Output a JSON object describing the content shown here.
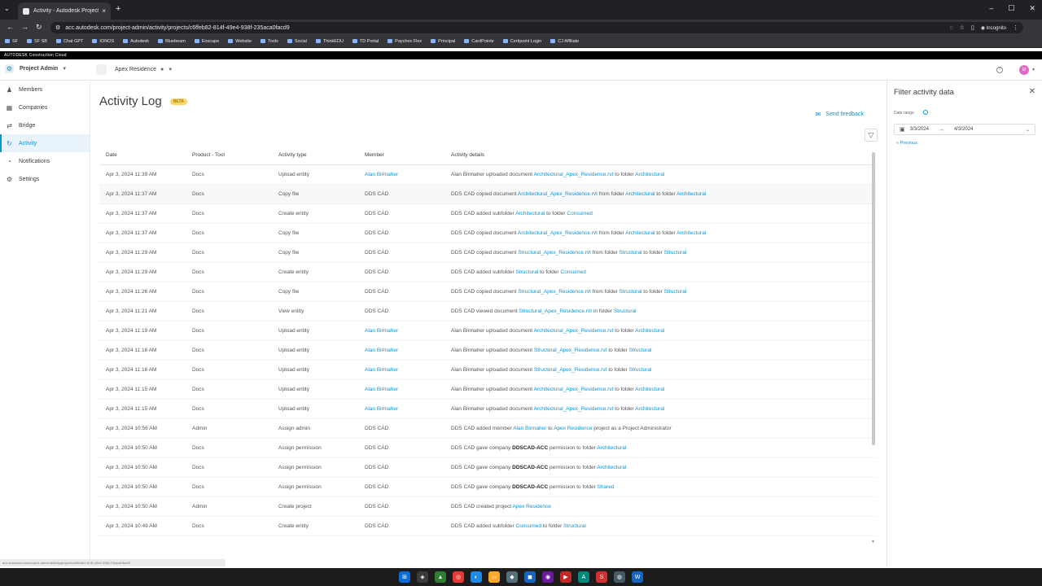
{
  "browser": {
    "tab_title": "Activity - Autodesk Project Adm",
    "tab_close": "×",
    "new_tab": "+",
    "url": "acc.autodesk.com/project-admin/activity/projects/c6ffeb82-814f-49e4-938f-235aca0facd9",
    "profile_label": "Incognito",
    "bookmarks": [
      "SF",
      "SF SB",
      "Chat GPT",
      "IONOS",
      "Autodesk",
      "Bluebeam",
      "Enscape",
      "Website",
      "Tools",
      "Social",
      "ThinkEDU",
      "TD Portal",
      "Paychex Flex",
      "Principal",
      "CardPointe",
      "Certipoint Login",
      "CJ Affiliate"
    ]
  },
  "brand_bar": "AUTODESK Construction Cloud",
  "header": {
    "module": "Project Admin",
    "project": "Apex Residence",
    "avatar_initials": "EI"
  },
  "sidebar": {
    "items": [
      {
        "label": "Members",
        "icon": "members-icon"
      },
      {
        "label": "Companies",
        "icon": "companies-icon"
      },
      {
        "label": "Bridge",
        "icon": "bridge-icon"
      },
      {
        "label": "Activity",
        "icon": "activity-icon",
        "active": true
      },
      {
        "label": "Notifications",
        "icon": "notifications-icon"
      },
      {
        "label": "Settings",
        "icon": "settings-icon"
      }
    ]
  },
  "main": {
    "title": "Activity Log",
    "beta_badge": "BETA",
    "feedback_label": "Send feedback"
  },
  "table": {
    "columns": [
      "Date",
      "Product - Tool",
      "Activity type",
      "Member",
      "Activity details"
    ],
    "rows": [
      {
        "date": "Apr 3, 2024 11:39 AM",
        "product": "Docs",
        "type": "Upload entity",
        "member": "Alan Birmaher",
        "member_link": true,
        "details": [
          [
            "t",
            "Alan Birmaher uploaded document "
          ],
          [
            "l",
            "Architectural_Apex_Residence.rvt"
          ],
          [
            "t",
            " to folder "
          ],
          [
            "l",
            "Architectural"
          ]
        ]
      },
      {
        "date": "Apr 3, 2024 11:37 AM",
        "product": "Docs",
        "type": "Copy file",
        "member": "DDS CAD",
        "member_link": false,
        "details": [
          [
            "t",
            "DDS CAD copied document "
          ],
          [
            "l",
            "Architectural_Apex_Residence.rvt"
          ],
          [
            "t",
            " from folder "
          ],
          [
            "l",
            "Architectural"
          ],
          [
            "t",
            " to folder "
          ],
          [
            "l",
            "Architectural"
          ]
        ]
      },
      {
        "date": "Apr 3, 2024 11:37 AM",
        "product": "Docs",
        "type": "Create entity",
        "member": "DDS CAD",
        "member_link": false,
        "details": [
          [
            "t",
            "DDS CAD added subfolder "
          ],
          [
            "l",
            "Architectural"
          ],
          [
            "t",
            " to folder "
          ],
          [
            "l",
            "Consumed"
          ]
        ]
      },
      {
        "date": "Apr 3, 2024 11:37 AM",
        "product": "Docs",
        "type": "Copy file",
        "member": "DDS CAD",
        "member_link": false,
        "details": [
          [
            "t",
            "DDS CAD copied document "
          ],
          [
            "l",
            "Architectural_Apex_Residence.rvt"
          ],
          [
            "t",
            " from folder "
          ],
          [
            "l",
            "Architectural"
          ],
          [
            "t",
            " to folder "
          ],
          [
            "l",
            "Architectural"
          ]
        ]
      },
      {
        "date": "Apr 3, 2024 11:29 AM",
        "product": "Docs",
        "type": "Copy file",
        "member": "DDS CAD",
        "member_link": false,
        "details": [
          [
            "t",
            "DDS CAD copied document "
          ],
          [
            "l",
            "Structural_Apex_Residence.rvt"
          ],
          [
            "t",
            " from folder "
          ],
          [
            "l",
            "Structural"
          ],
          [
            "t",
            " to folder "
          ],
          [
            "l",
            "Structural"
          ]
        ]
      },
      {
        "date": "Apr 3, 2024 11:29 AM",
        "product": "Docs",
        "type": "Create entity",
        "member": "DDS CAD",
        "member_link": false,
        "details": [
          [
            "t",
            "DDS CAD added subfolder "
          ],
          [
            "l",
            "Structural"
          ],
          [
            "t",
            " to folder "
          ],
          [
            "l",
            "Consumed"
          ]
        ]
      },
      {
        "date": "Apr 3, 2024 11:26 AM",
        "product": "Docs",
        "type": "Copy file",
        "member": "DDS CAD",
        "member_link": false,
        "details": [
          [
            "t",
            "DDS CAD copied document "
          ],
          [
            "l",
            "Structural_Apex_Residence.rvt"
          ],
          [
            "t",
            " from folder "
          ],
          [
            "l",
            "Structural"
          ],
          [
            "t",
            " to folder "
          ],
          [
            "l",
            "Structural"
          ]
        ]
      },
      {
        "date": "Apr 3, 2024 11:21 AM",
        "product": "Docs",
        "type": "View entity",
        "member": "DDS CAD",
        "member_link": false,
        "details": [
          [
            "t",
            "DDS CAD viewed document "
          ],
          [
            "l",
            "Structural_Apex_Residence.rvt"
          ],
          [
            "t",
            " in folder "
          ],
          [
            "l",
            "Structural"
          ]
        ]
      },
      {
        "date": "Apr 3, 2024 11:19 AM",
        "product": "Docs",
        "type": "Upload entity",
        "member": "Alan Birmaher",
        "member_link": true,
        "details": [
          [
            "t",
            "Alan Birmaher uploaded document "
          ],
          [
            "l",
            "Architectural_Apex_Residence.rvt"
          ],
          [
            "t",
            " to folder "
          ],
          [
            "l",
            "Architectural"
          ]
        ]
      },
      {
        "date": "Apr 3, 2024 11:16 AM",
        "product": "Docs",
        "type": "Upload entity",
        "member": "Alan Birmaher",
        "member_link": true,
        "details": [
          [
            "t",
            "Alan Birmaher uploaded document "
          ],
          [
            "l",
            "Structural_Apex_Residence.rvt"
          ],
          [
            "t",
            " to folder "
          ],
          [
            "l",
            "Structural"
          ]
        ]
      },
      {
        "date": "Apr 3, 2024 11:16 AM",
        "product": "Docs",
        "type": "Upload entity",
        "member": "Alan Birmaher",
        "member_link": true,
        "details": [
          [
            "t",
            "Alan Birmaher uploaded document "
          ],
          [
            "l",
            "Structural_Apex_Residence.rvt"
          ],
          [
            "t",
            " to folder "
          ],
          [
            "l",
            "Structural"
          ]
        ]
      },
      {
        "date": "Apr 3, 2024 11:15 AM",
        "product": "Docs",
        "type": "Upload entity",
        "member": "Alan Birmaher",
        "member_link": true,
        "details": [
          [
            "t",
            "Alan Birmaher uploaded document "
          ],
          [
            "l",
            "Architectural_Apex_Residence.rvt"
          ],
          [
            "t",
            " to folder "
          ],
          [
            "l",
            "Architectural"
          ]
        ]
      },
      {
        "date": "Apr 3, 2024 11:15 AM",
        "product": "Docs",
        "type": "Upload entity",
        "member": "Alan Birmaher",
        "member_link": true,
        "details": [
          [
            "t",
            "Alan Birmaher uploaded document "
          ],
          [
            "l",
            "Architectural_Apex_Residence.rvt"
          ],
          [
            "t",
            " to folder "
          ],
          [
            "l",
            "Architectural"
          ]
        ]
      },
      {
        "date": "Apr 3, 2024 10:56 AM",
        "product": "Admin",
        "type": "Assign admin",
        "member": "DDS CAD",
        "member_link": false,
        "details": [
          [
            "t",
            "DDS CAD added member "
          ],
          [
            "l",
            "Alan Birmaher"
          ],
          [
            "t",
            " to "
          ],
          [
            "l",
            "Apex Residence"
          ],
          [
            "t",
            " project as a Project Administrator"
          ]
        ]
      },
      {
        "date": "Apr 3, 2024 10:50 AM",
        "product": "Docs",
        "type": "Assign permission",
        "member": "DDS CAD",
        "member_link": false,
        "details": [
          [
            "t",
            "DDS CAD gave company "
          ],
          [
            "b",
            "DDSCAD-ACC"
          ],
          [
            "t",
            " permission to folder "
          ],
          [
            "l",
            "Architectural"
          ]
        ]
      },
      {
        "date": "Apr 3, 2024 10:50 AM",
        "product": "Docs",
        "type": "Assign permission",
        "member": "DDS CAD",
        "member_link": false,
        "details": [
          [
            "t",
            "DDS CAD gave company "
          ],
          [
            "b",
            "DDSCAD-ACC"
          ],
          [
            "t",
            " permission to folder "
          ],
          [
            "l",
            "Architectural"
          ]
        ]
      },
      {
        "date": "Apr 3, 2024 10:50 AM",
        "product": "Docs",
        "type": "Assign permission",
        "member": "DDS CAD",
        "member_link": false,
        "details": [
          [
            "t",
            "DDS CAD gave company "
          ],
          [
            "b",
            "DDSCAD-ACC"
          ],
          [
            "t",
            " permission to folder "
          ],
          [
            "l",
            "Shared"
          ]
        ]
      },
      {
        "date": "Apr 3, 2024 10:50 AM",
        "product": "Admin",
        "type": "Create project",
        "member": "DDS CAD",
        "member_link": false,
        "details": [
          [
            "t",
            "DDS CAD created project "
          ],
          [
            "l",
            "Apex Residence"
          ]
        ]
      },
      {
        "date": "Apr 3, 2024 10:49 AM",
        "product": "Docs",
        "type": "Create entity",
        "member": "DDS CAD",
        "member_link": false,
        "details": [
          [
            "t",
            "DDS CAD added subfolder "
          ],
          [
            "l",
            "Consumed"
          ],
          [
            "t",
            " to folder "
          ],
          [
            "l",
            "Structural"
          ]
        ]
      }
    ]
  },
  "filter_panel": {
    "title": "Filter activity data",
    "date_range_label": "Date range",
    "start_date": "3/3/2024",
    "end_date": "4/3/2024",
    "previous_label": "Previous"
  },
  "colors": {
    "accent": "#0696d7",
    "beta": "#fcd563"
  }
}
